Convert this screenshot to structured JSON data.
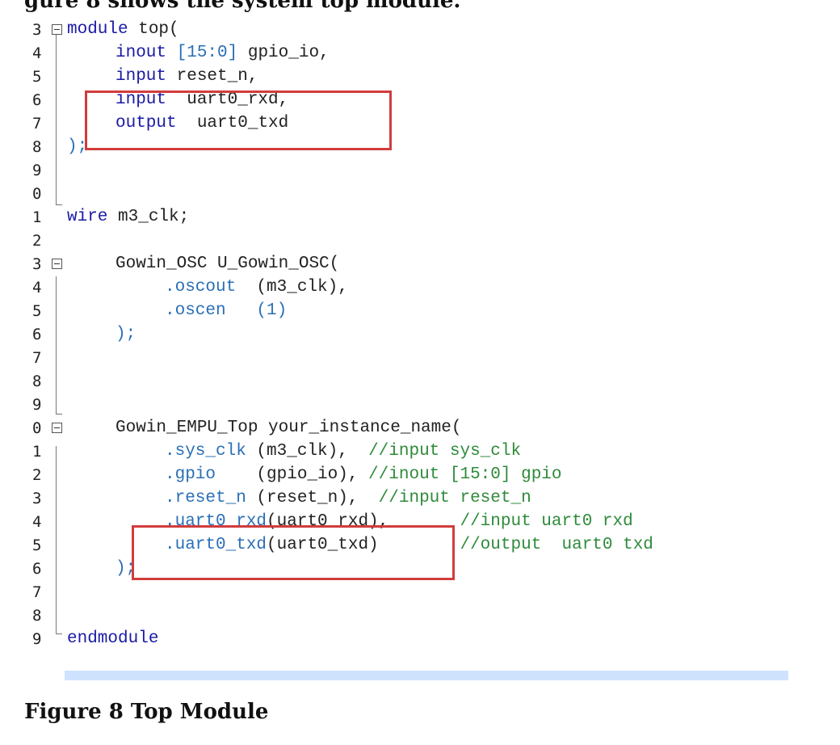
{
  "page_top_text": "gure 8 shows the system top module.",
  "caption": "Figure 8 Top Module",
  "line_numbers": [
    "3",
    "4",
    "5",
    "6",
    "7",
    "8",
    "9",
    "0",
    "1",
    "2",
    "3",
    "4",
    "5",
    "6",
    "7",
    "8",
    "9",
    "0",
    "1",
    "2",
    "3",
    "4",
    "5",
    "6",
    "7",
    "8",
    "9"
  ],
  "code": {
    "l1": {
      "kw": "module",
      "rest": " top("
    },
    "l2": {
      "kw": "inout",
      "port": "[15:0]",
      "rest": " gpio_io,"
    },
    "l3": {
      "kw": "input",
      "rest": " reset_n,"
    },
    "l4": {
      "kw": "input",
      "rest": "  uart0_rxd,"
    },
    "l5": {
      "kw": "output",
      "rest": "  uart0_txd"
    },
    "l6": {
      "rest": ");"
    },
    "l9": {
      "kw": "wire",
      "rest": " m3_clk;"
    },
    "l11": {
      "rest": "Gowin_OSC U_Gowin_OSC("
    },
    "l12": {
      "a": ".oscout",
      "b": "  (m3_clk),"
    },
    "l13": {
      "a": ".oscen",
      "b": "   (1)"
    },
    "l14": {
      "rest": ");"
    },
    "l18": {
      "rest": "Gowin_EMPU_Top your_instance_name("
    },
    "l19": {
      "a": ".sys_clk",
      "b": " (m3_clk),",
      "c": "  //input sys_clk"
    },
    "l20": {
      "a": ".gpio",
      "b": "    (gpio_io),",
      "c": " //inout [15:0] gpio"
    },
    "l21": {
      "a": ".reset_n",
      "b": " (reset_n),",
      "c": "  //input reset_n"
    },
    "l22": {
      "a": ".uart0_rxd",
      "b": "(uart0_rxd),",
      "c": "       //input uart0 rxd"
    },
    "l23": {
      "a": ".uart0_txd",
      "b": "(uart0_txd)",
      "c": "        //output  uart0 txd"
    },
    "l24": {
      "rest": ");"
    },
    "l26": {
      "kw": "endmodule"
    }
  },
  "colors": {
    "keyword": "#1a1aa6",
    "punct": "#2a6fb5",
    "comment": "#2e8b3a",
    "highlight_box": "#d23c3c"
  }
}
